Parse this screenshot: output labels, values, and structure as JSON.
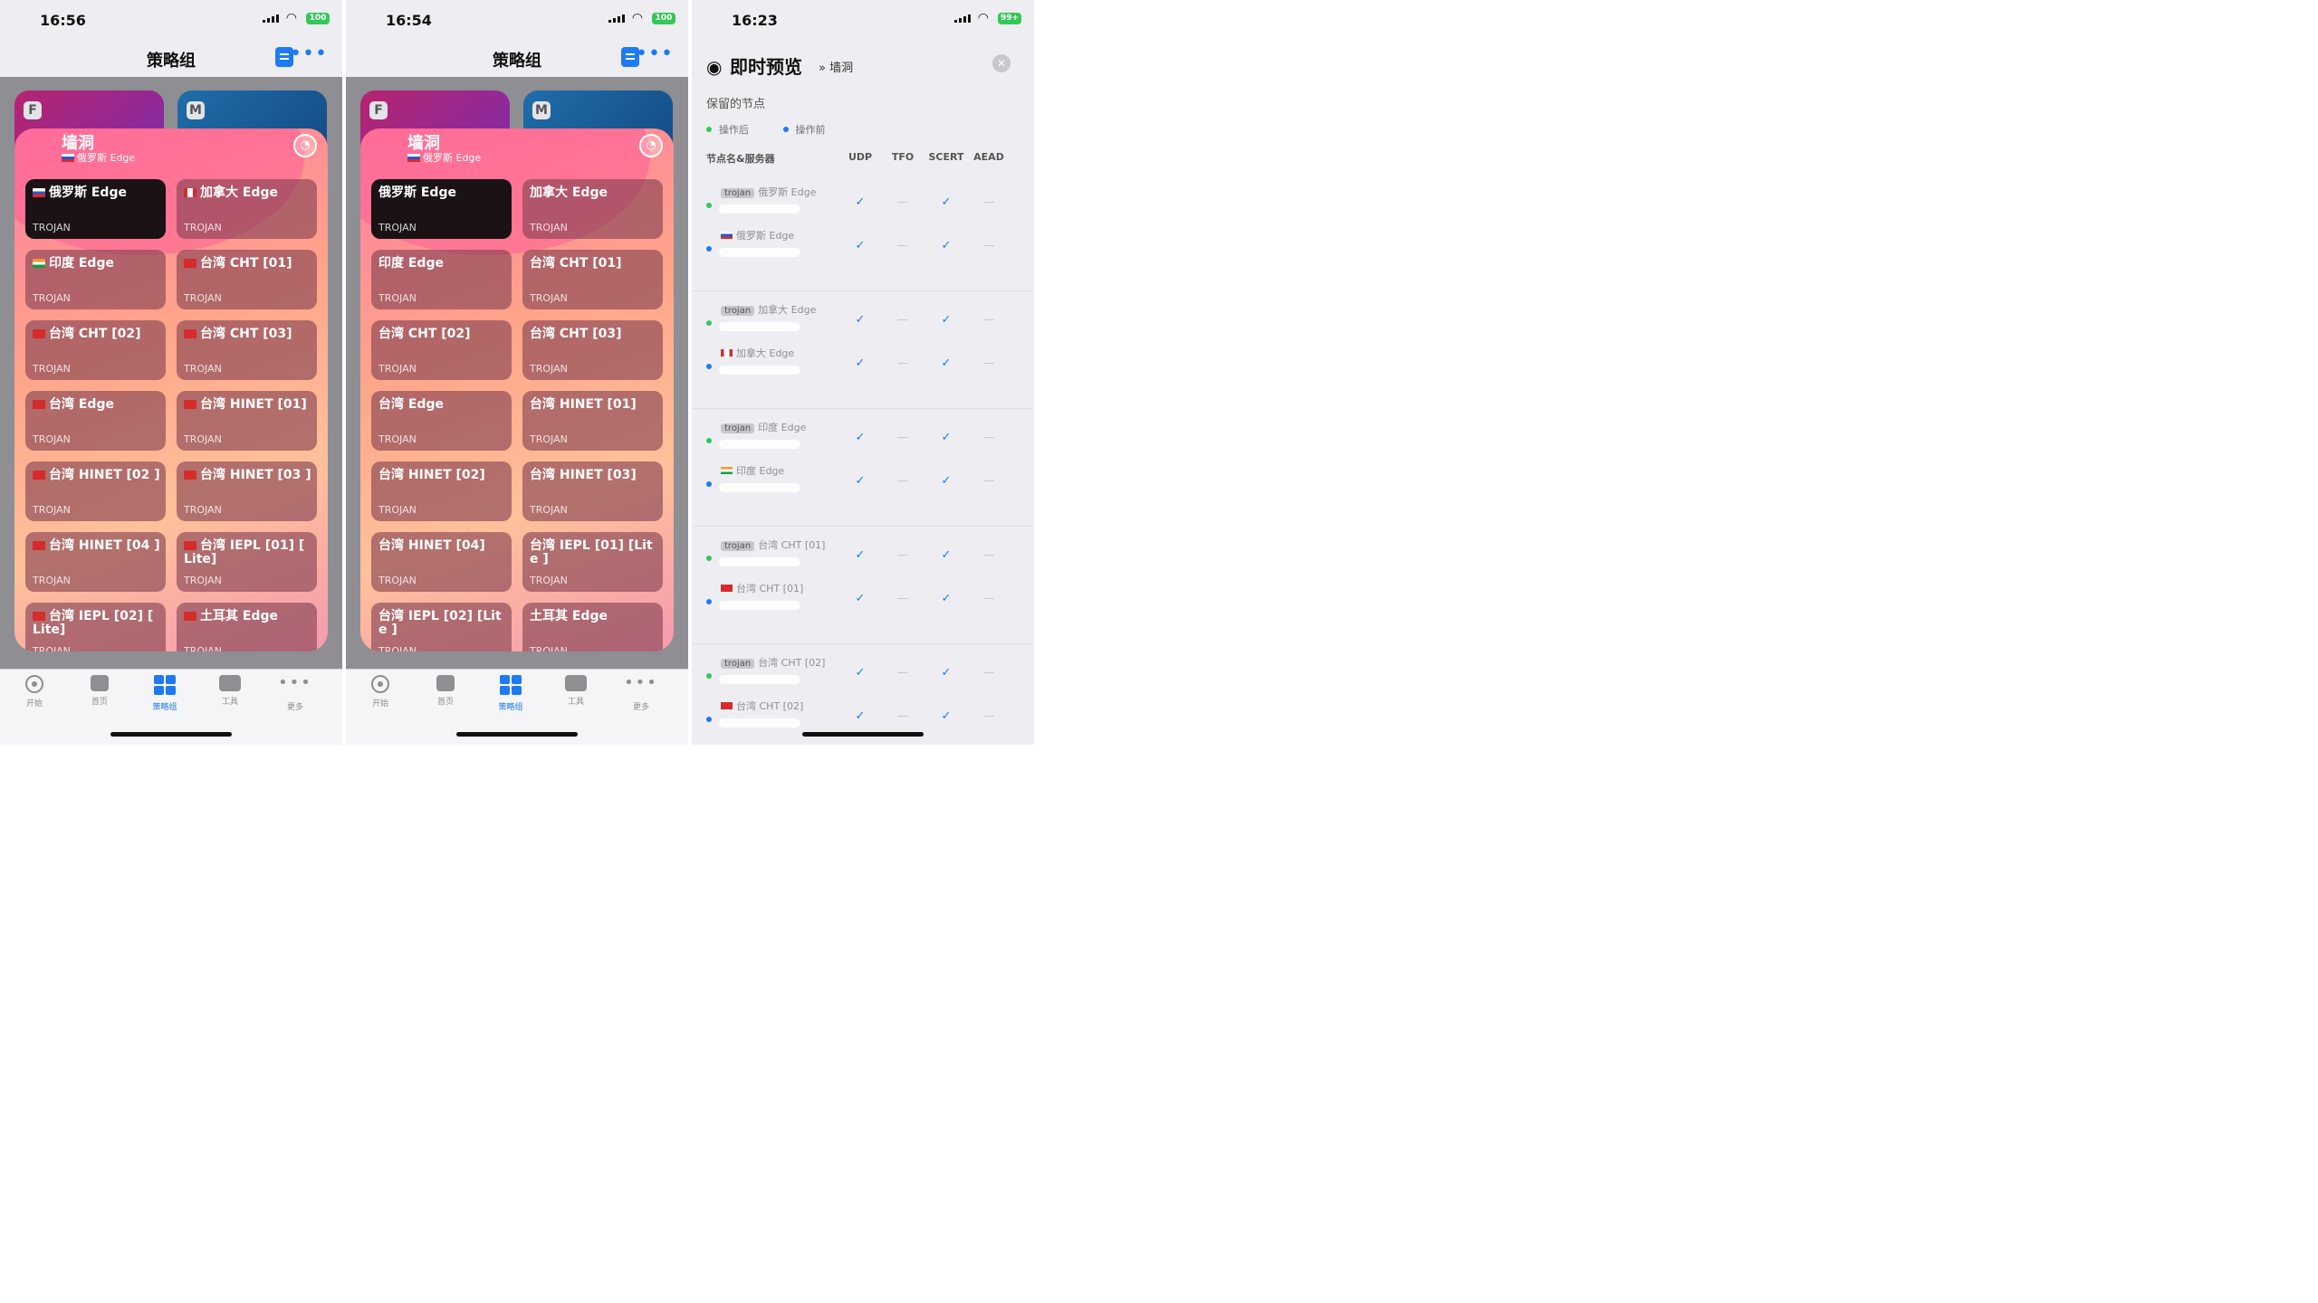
{
  "screens": [
    {
      "time": "16:56",
      "battery": "100",
      "nav_title": "策略组",
      "bg_cards": [
        "F",
        "M"
      ],
      "group_title": "墙洞",
      "group_selected": "俄罗斯 Edge",
      "show_flags": true,
      "nodes": [
        {
          "name": "俄罗斯 Edge",
          "type": "TROJAN",
          "selected": true
        },
        {
          "name": "加拿大 Edge",
          "type": "TROJAN"
        },
        {
          "name": "印度 Edge",
          "type": "TROJAN"
        },
        {
          "name": "台湾 CHT [01]",
          "type": "TROJAN"
        },
        {
          "name": "台湾 CHT [02]",
          "type": "TROJAN"
        },
        {
          "name": "台湾 CHT [03]",
          "type": "TROJAN"
        },
        {
          "name": "台湾 Edge",
          "type": "TROJAN"
        },
        {
          "name": "台湾 HINET [01]",
          "type": "TROJAN"
        },
        {
          "name": "台湾 HINET [02 ]",
          "type": "TROJAN"
        },
        {
          "name": "台湾 HINET [03 ]",
          "type": "TROJAN"
        },
        {
          "name": "台湾 HINET [04 ]",
          "type": "TROJAN"
        },
        {
          "name": "台湾 IEPL [01] [ Lite]",
          "type": "TROJAN"
        },
        {
          "name": "台湾 IEPL [02] [ Lite]",
          "type": "TROJAN"
        },
        {
          "name": "土耳其 Edge",
          "type": "TROJAN"
        }
      ],
      "tabs": [
        "开始",
        "首页",
        "策略组",
        "工具",
        "更多"
      ],
      "active_tab": 2
    },
    {
      "time": "16:54",
      "battery": "100",
      "nav_title": "策略组",
      "bg_cards": [
        "F",
        "M"
      ],
      "group_title": "墙洞",
      "group_selected": "俄罗斯 Edge",
      "show_flags": false,
      "nodes": [
        {
          "name": "俄罗斯 Edge",
          "type": "TROJAN",
          "selected": true
        },
        {
          "name": "加拿大 Edge",
          "type": "TROJAN"
        },
        {
          "name": "印度 Edge",
          "type": "TROJAN"
        },
        {
          "name": "台湾 CHT [01]",
          "type": "TROJAN"
        },
        {
          "name": "台湾 CHT [02]",
          "type": "TROJAN"
        },
        {
          "name": "台湾 CHT [03]",
          "type": "TROJAN"
        },
        {
          "name": "台湾 Edge",
          "type": "TROJAN"
        },
        {
          "name": "台湾 HINET [01]",
          "type": "TROJAN"
        },
        {
          "name": "台湾 HINET [02]",
          "type": "TROJAN"
        },
        {
          "name": "台湾 HINET [03]",
          "type": "TROJAN"
        },
        {
          "name": "台湾 HINET [04]",
          "type": "TROJAN"
        },
        {
          "name": "台湾 IEPL [01] [Lite ]",
          "type": "TROJAN"
        },
        {
          "name": "台湾 IEPL [02] [Lite ]",
          "type": "TROJAN"
        },
        {
          "name": "土耳其 Edge",
          "type": "TROJAN"
        }
      ],
      "tabs": [
        "开始",
        "首页",
        "策略组",
        "工具",
        "更多"
      ],
      "active_tab": 2
    }
  ],
  "preview": {
    "time": "16:23",
    "battery": "99+",
    "title": "即时预览",
    "breadcrumb": "» 墙洞",
    "section": "保留的节点",
    "legend_after": "操作后",
    "legend_before": "操作前",
    "columns": [
      "节点名&服务器",
      "UDP",
      "TFO",
      "SCERT",
      "AEAD"
    ],
    "badge": "trojan",
    "groups": [
      {
        "name": "俄罗斯 Edge",
        "flag": "ru"
      },
      {
        "name": "加拿大 Edge",
        "flag": "ca"
      },
      {
        "name": "印度 Edge",
        "flag": "in"
      },
      {
        "name": "台湾 CHT [01]",
        "flag": "tw"
      },
      {
        "name": "台湾 CHT [02]",
        "flag": "tw"
      }
    ],
    "checks": [
      "✓",
      "—",
      "✓",
      "—"
    ]
  },
  "colors": {
    "accent": "#1d7af3",
    "after_dot": "#34c759",
    "before_dot": "#1d7af3",
    "battery": "#34c759"
  }
}
